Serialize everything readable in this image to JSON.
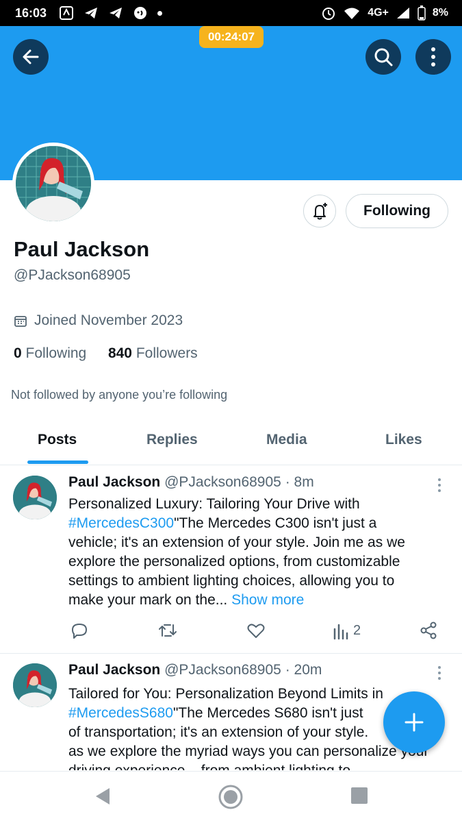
{
  "status_bar": {
    "time": "16:03",
    "network": "4G+",
    "battery": "8%"
  },
  "header": {
    "timer": "00:24:07",
    "banner_color": "#1d9bf0"
  },
  "profile": {
    "name": "Paul Jackson",
    "handle": "@PJackson68905",
    "joined": "Joined November 2023",
    "following_count": "0",
    "following_label": "Following",
    "followers_count": "840",
    "followers_label": "Followers",
    "not_followed": "Not followed by anyone you’re following",
    "follow_button": "Following"
  },
  "tabs": [
    {
      "label": "Posts",
      "active": true
    },
    {
      "label": "Replies",
      "active": false
    },
    {
      "label": "Media",
      "active": false
    },
    {
      "label": "Likes",
      "active": false
    }
  ],
  "posts": [
    {
      "author": "Paul Jackson",
      "handle": "@PJackson68905",
      "time": "· 8m",
      "lines": [
        "Personalized Luxury: Tailoring Your Drive with",
        "\"The Mercedes C300 isn't just a",
        "vehicle; it's an extension of your style. Join me as we",
        "explore the personalized options, from customizable",
        "settings to ambient lighting choices, allowing you to",
        "make your mark on the..."
      ],
      "hashtag": "#MercedesC300",
      "show_more": "Show more",
      "views": "2"
    },
    {
      "author": "Paul Jackson",
      "handle": "@PJackson68905",
      "time": "· 20m",
      "lines": [
        "Tailored for You: Personalization Beyond Limits in",
        "\"The Mercedes S680 isn't just",
        "of transportation; it's an extension of your style.",
        "as we explore the myriad ways you can personalize your",
        "driving experience... from ambient lighting to"
      ],
      "hashtag": "#MercedesS680"
    }
  ],
  "icons": {
    "back": "arrow-left-icon",
    "search": "search-icon",
    "more": "more-vertical-icon",
    "bell": "bell-plus-icon",
    "calendar": "calendar-icon",
    "compose": "plus-icon"
  },
  "colors": {
    "accent": "#1d9bf0",
    "timer": "#f6b31d",
    "header_buttons": "#0f3a5c"
  }
}
